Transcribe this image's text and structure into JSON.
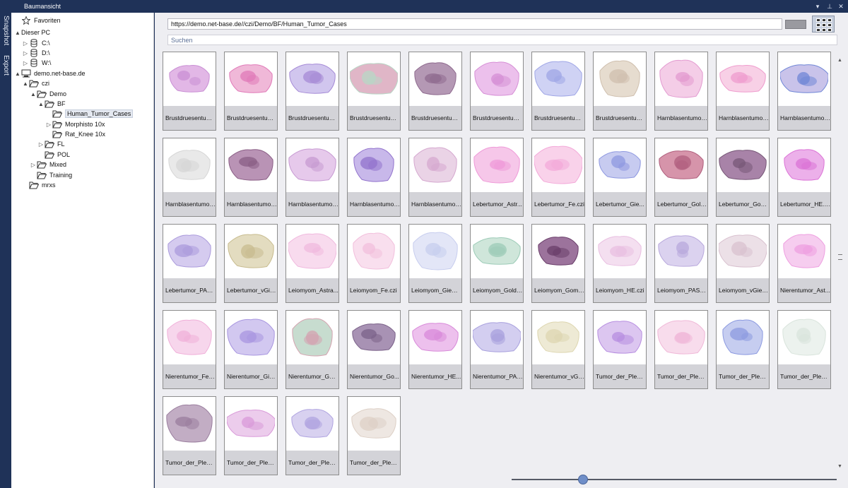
{
  "window": {
    "title": "Baumansicht",
    "pin_icon": "pin-icon",
    "close_icon": "close-icon"
  },
  "side_tabs": [
    "Snapshot",
    "Export"
  ],
  "tree": [
    {
      "label": "Favoriten",
      "icon": "star-icon",
      "level": 0,
      "arrow": ""
    },
    {
      "label": "Dieser PC",
      "icon": "",
      "level": 0,
      "arrow": "▲"
    },
    {
      "label": "C:\\",
      "icon": "drive-icon",
      "level": 1,
      "arrow": "▷"
    },
    {
      "label": "D:\\",
      "icon": "drive-icon",
      "level": 1,
      "arrow": "▷"
    },
    {
      "label": "W:\\",
      "icon": "drive-icon",
      "level": 1,
      "arrow": "▷"
    },
    {
      "label": "demo.net-base.de",
      "icon": "server-icon",
      "level": 0,
      "arrow": "▲"
    },
    {
      "label": "czi",
      "icon": "folder-open-icon",
      "level": 1,
      "arrow": "▲"
    },
    {
      "label": "Demo",
      "icon": "folder-open-icon",
      "level": 2,
      "arrow": "▲"
    },
    {
      "label": "BF",
      "icon": "folder-open-icon",
      "level": 3,
      "arrow": "▲"
    },
    {
      "label": "Human_Tumor_Cases",
      "icon": "folder-open-icon",
      "level": 4,
      "arrow": "",
      "selected": true
    },
    {
      "label": "Morphisto 10x",
      "icon": "folder-open-icon",
      "level": 4,
      "arrow": "▷"
    },
    {
      "label": "Rat_Knee 10x",
      "icon": "folder-open-icon",
      "level": 4,
      "arrow": ""
    },
    {
      "label": "FL",
      "icon": "folder-open-icon",
      "level": 3,
      "arrow": "▷"
    },
    {
      "label": "POL",
      "icon": "folder-open-icon",
      "level": 3,
      "arrow": ""
    },
    {
      "label": "Mixed",
      "icon": "folder-open-icon",
      "level": 2,
      "arrow": "▷"
    },
    {
      "label": "Training",
      "icon": "folder-open-icon",
      "level": 2,
      "arrow": ""
    },
    {
      "label": "mrxs",
      "icon": "folder-open-icon",
      "level": 1,
      "arrow": ""
    }
  ],
  "address": {
    "url": "https://demo.net-base.de//czi/Demo/BF/Human_Tumor_Cases",
    "search_placeholder": "Suchen"
  },
  "thumbnail_view_icon": "grid-view-icon",
  "tiles": [
    {
      "label": "Brustdruesentum...",
      "color": "#c98fd4",
      "accent": "#e2b7e6"
    },
    {
      "label": "Brustdruesentum...",
      "color": "#e07ab8",
      "accent": "#f0b8d8"
    },
    {
      "label": "Brustdruesentum...",
      "color": "#a58ad6",
      "accent": "#d1c6ee"
    },
    {
      "label": "Brustdruesentum...",
      "color": "#b8d7c6",
      "accent": "#e0b6c7"
    },
    {
      "label": "Brustdruesentum...",
      "color": "#8f6b8f",
      "accent": "#b498b4"
    },
    {
      "label": "Brustdruesentum...",
      "color": "#d68fd6",
      "accent": "#ecc0ec"
    },
    {
      "label": "Brustdruesentum...",
      "color": "#9fa6e6",
      "accent": "#cfd2f4"
    },
    {
      "label": "Brustdruesentum...",
      "color": "#cfbfae",
      "accent": "#e6dccf"
    },
    {
      "label": "Harnblasentumor...",
      "color": "#e39ad0",
      "accent": "#f4cde7"
    },
    {
      "label": "Harnblasentumor...",
      "color": "#ef9ccd",
      "accent": "#f8d0e6"
    },
    {
      "label": "Harnblasentumor...",
      "color": "#6f86d6",
      "accent": "#c9c3ea"
    },
    {
      "label": "Harnblasentumor...",
      "color": "#d6d6d6",
      "accent": "#e9e9e9"
    },
    {
      "label": "Harnblasentumor...",
      "color": "#8a5e85",
      "accent": "#b993b5"
    },
    {
      "label": "Harnblasentumor...",
      "color": "#c79ad2",
      "accent": "#e6c9eb"
    },
    {
      "label": "Harnblasentumor...",
      "color": "#9273cc",
      "accent": "#c8b8ea"
    },
    {
      "label": "Harnblasentumor...",
      "color": "#d5a8cf",
      "accent": "#ead3e6"
    },
    {
      "label": "Lebertumor_Astr...",
      "color": "#ef9ad8",
      "accent": "#f6c7e9"
    },
    {
      "label": "Lebertumor_Fe.czi",
      "color": "#f3a9d9",
      "accent": "#f9d2ea"
    },
    {
      "label": "Lebertumor_Gie...",
      "color": "#8e98e0",
      "accent": "#c7cbf0"
    },
    {
      "label": "Lebertumor_Gold...",
      "color": "#b05f7d",
      "accent": "#d694aa"
    },
    {
      "label": "Lebertumor_Gom...",
      "color": "#775777",
      "accent": "#a883a8"
    },
    {
      "label": "Lebertumor_HE.czi",
      "color": "#db73d6",
      "accent": "#ecb0ea"
    },
    {
      "label": "Lebertumor_PAS...",
      "color": "#ab9bdc",
      "accent": "#d5cbef"
    },
    {
      "label": "Lebertumor_vGie...",
      "color": "#c8bc8f",
      "accent": "#e3dcc0"
    },
    {
      "label": "Leiomyom_Astra...",
      "color": "#f0b9de",
      "accent": "#f8dbee"
    },
    {
      "label": "Leiomyom_Fe.czi",
      "color": "#f2bfdc",
      "accent": "#f9dfee"
    },
    {
      "label": "Leiomyom_Giem...",
      "color": "#c7cdee",
      "accent": "#e3e6f7"
    },
    {
      "label": "Leiomyom_Goldn...",
      "color": "#9ccbb7",
      "accent": "#cfe6da"
    },
    {
      "label": "Leiomyom_Gomo...",
      "color": "#6a3e6a",
      "accent": "#9c739c"
    },
    {
      "label": "Leiomyom_HE.czi",
      "color": "#e9bfe1",
      "accent": "#f4dff0"
    },
    {
      "label": "Leiomyom_PAS.czi",
      "color": "#b8a8dc",
      "accent": "#dbd2ef"
    },
    {
      "label": "Leiomyom_vGies...",
      "color": "#d9c1cf",
      "accent": "#ece0e7"
    },
    {
      "label": "Nierentumor_Ast...",
      "color": "#ee9fe0",
      "accent": "#f6cdef"
    },
    {
      "label": "Nierentumor_Fe.czi",
      "color": "#f0b0d9",
      "accent": "#f7d6ec"
    },
    {
      "label": "Nierentumor_Gie...",
      "color": "#a896e0",
      "accent": "#d2c8f0"
    },
    {
      "label": "Nierentumor_Gol...",
      "color": "#d4a3b0",
      "accent": "#c7dccf"
    },
    {
      "label": "Nierentumor_Go...",
      "color": "#7b6289",
      "accent": "#a892b4"
    },
    {
      "label": "Nierentumor_HE...",
      "color": "#d88ad9",
      "accent": "#edc0ed"
    },
    {
      "label": "Nierentumor_PAS...",
      "color": "#a8a0dd",
      "accent": "#d3cef0"
    },
    {
      "label": "Nierentumor_vGi...",
      "color": "#ddd6b0",
      "accent": "#eeead5"
    },
    {
      "label": "Tumor_der_Pleur...",
      "color": "#b78ee0",
      "accent": "#dcc6f0"
    },
    {
      "label": "Tumor_der_Pleur...",
      "color": "#f0b8d8",
      "accent": "#f8dcec"
    },
    {
      "label": "Tumor_der_Pleur...",
      "color": "#8c9ae0",
      "accent": "#c6cdf0"
    },
    {
      "label": "Tumor_der_Pleur...",
      "color": "#d9e4dc",
      "accent": "#ecf2ee"
    },
    {
      "label": "Tumor_der_Pleur...",
      "color": "#9a7e9e",
      "accent": "#c2adc4"
    },
    {
      "label": "Tumor_der_Pleur...",
      "color": "#d99ad9",
      "accent": "#ecccec"
    },
    {
      "label": "Tumor_der_Pleur...",
      "color": "#b0a4e0",
      "accent": "#d8d1f0"
    },
    {
      "label": "Tumor_der_Pleur...",
      "color": "#ddd0c6",
      "accent": "#eee7e2"
    }
  ],
  "zoom_slider": {
    "position": 0.22,
    "icon": "slider-knob"
  }
}
